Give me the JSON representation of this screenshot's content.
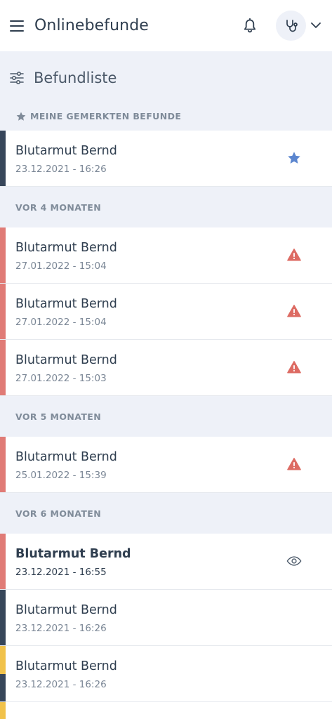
{
  "header": {
    "title": "Onlinebefunde",
    "icons": {
      "menu": "menu-icon",
      "bell": "bell-icon",
      "avatar": "stethoscope-icon",
      "chevron": "chevron-down-icon"
    }
  },
  "list": {
    "title": "Befundliste",
    "filter_icon": "filter-sliders-icon"
  },
  "colors": {
    "red": "#e07b76",
    "dark": "#37465a",
    "yellow": "#f1c24b",
    "star": "#5b86cf",
    "warning": "#dd6b63"
  },
  "sections": [
    {
      "label": "MEINE GEMERKTEN BEFUNDE",
      "items": [
        {
          "name": "Blutarmut Bernd",
          "date": "23.12.2021 - 16:26",
          "status": "star"
        }
      ]
    },
    {
      "label": "VOR 4 MONATEN",
      "items": [
        {
          "name": "Blutarmut Bernd",
          "date": "27.01.2022 - 15:04",
          "status": "warning"
        },
        {
          "name": "Blutarmut Bernd",
          "date": "27.01.2022 - 15:04",
          "status": "warning"
        },
        {
          "name": "Blutarmut Bernd",
          "date": "27.01.2022 - 15:03",
          "status": "warning"
        }
      ]
    },
    {
      "label": "VOR 5 MONATEN",
      "items": [
        {
          "name": "Blutarmut Bernd",
          "date": "25.01.2022 - 15:39",
          "status": "warning"
        }
      ]
    },
    {
      "label": "VOR 6 MONATEN",
      "items": [
        {
          "name": "Blutarmut Bernd",
          "date": "23.12.2021 - 16:55",
          "status": "unread"
        },
        {
          "name": "Blutarmut Bernd",
          "date": "23.12.2021 - 16:26",
          "status": "none"
        },
        {
          "name": "Blutarmut Bernd",
          "date": "23.12.2021 - 16:26",
          "status": "none"
        }
      ]
    }
  ]
}
